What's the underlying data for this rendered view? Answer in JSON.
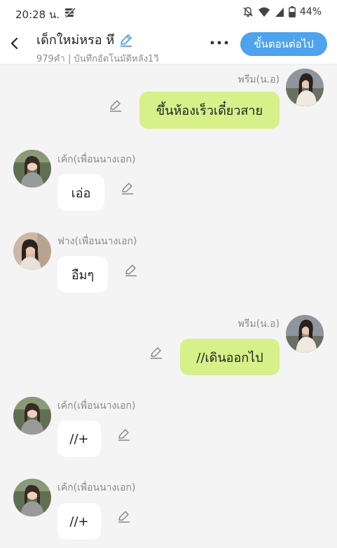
{
  "status_bar": {
    "time": "20:28 น.",
    "battery": "44%",
    "icons": [
      "data-saver-icon",
      "mute-icon",
      "wifi-icon",
      "signal-icon",
      "battery-icon"
    ]
  },
  "header": {
    "title": "เด็กใหม่หรอ หึ",
    "subtitle": "979คำ | บันทึกอัตโนมัติหลัง1วิ",
    "next_button": "ขั้นตอนต่อไป",
    "accent_color": "#4ea3ee"
  },
  "messages": [
    {
      "side": "right",
      "sender": "พรีม(น.อ)",
      "text": "ขึ้นห้องเร็วเดี๋ยวสาย"
    },
    {
      "side": "left",
      "sender": "เค้ก(เพื่อนนางเอก)",
      "text": "เอ่อ"
    },
    {
      "side": "left",
      "sender": "ฟาง(เพื่อนนางเอก)",
      "text": "อืมๆ"
    },
    {
      "side": "right",
      "sender": "พรีม(น.อ)",
      "text": "//เดินออกไป"
    },
    {
      "side": "left",
      "sender": "เค้ก(เพื่อนนางเอก)",
      "text": "//+"
    },
    {
      "side": "left",
      "sender": "เค้ก(เพื่อนนางเอก)",
      "text": "//+"
    }
  ],
  "colors": {
    "right_bubble": "#d6f08a",
    "left_bubble": "#ffffff",
    "background": "#f4f4f5"
  }
}
